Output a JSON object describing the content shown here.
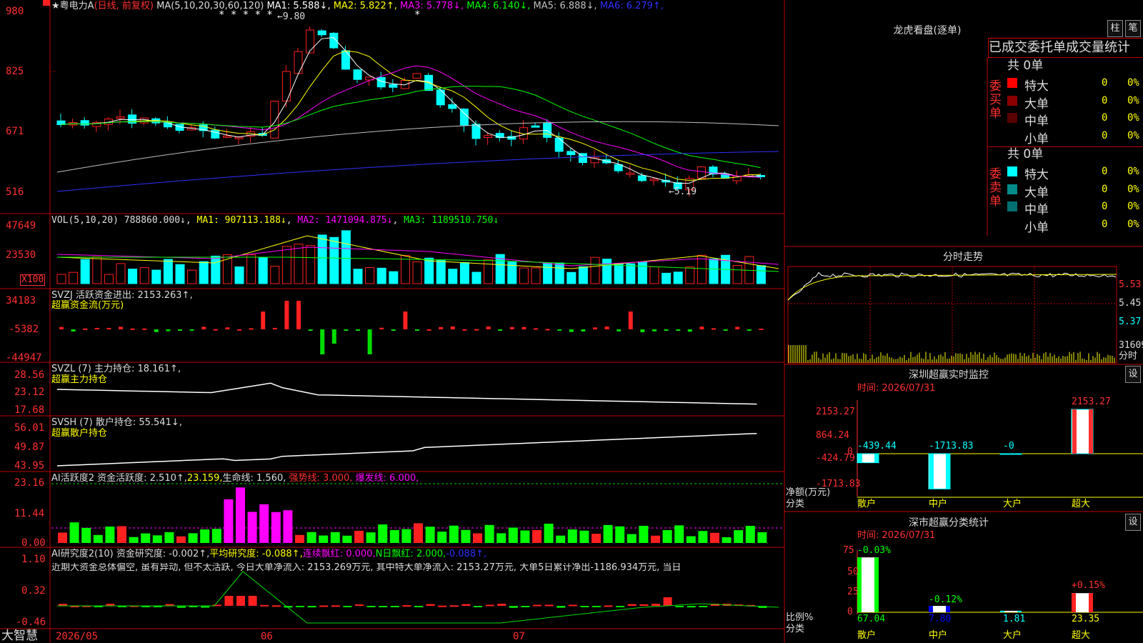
{
  "stock": {
    "name": "粤电力A",
    "period": "(日线, 前复权)",
    "ma_label": "MA(5,10,20,30,60,120)",
    "ma": [
      {
        "t": "MA1: 5.588↓",
        "c": "#ffffff"
      },
      {
        "t": "MA2: 5.822↑",
        "c": "#ffff00"
      },
      {
        "t": "MA3: 5.778↓",
        "c": "#ff00ff"
      },
      {
        "t": "MA4: 6.140↓",
        "c": "#00ff00"
      },
      {
        "t": "MA5: 6.888↓",
        "c": "#c0c0c0"
      },
      {
        "t": "MA6: 6.279↑",
        "c": "#3030ff"
      }
    ],
    "y_ticks": [
      "980",
      "825",
      "671",
      "516"
    ],
    "high_label": "9.80",
    "low_label": "←5.19",
    "stars": "* * * * *",
    "star_single": "*"
  },
  "vol": {
    "label": "VOL(5,10,20)",
    "value": "788860.000↓",
    "ma1": "MA1: 907113.188↓",
    "ma2": "MA2: 1471094.875↓",
    "ma3": "MA3: 1189510.750↓",
    "y_ticks": [
      "47649",
      "23530"
    ],
    "unit": "X100"
  },
  "svzj": {
    "label": "SVZJ  活跃资金进出: 2153.263↑,",
    "sub": "超赢资金流(万元)",
    "y_ticks": [
      "34183",
      "-5382",
      "-44947"
    ]
  },
  "svzl": {
    "label": "SVZL (7) 主力持仓: 18.161↑,",
    "sub": "超赢主力持仓",
    "y_ticks": [
      "28.56",
      "23.12",
      "17.68"
    ]
  },
  "svsh": {
    "label": "SVSH (7) 散户持仓: 55.541↓,",
    "sub": "超赢散户持仓",
    "y_ticks": [
      "56.01",
      "49.87",
      "43.95"
    ]
  },
  "ai1": {
    "label": "AI活跃度2 资金活跃度: 2.510↑,",
    "v2": "23.159,",
    "v3": "生命线: 1.560,",
    "v4": "强势线: 3.000,",
    "v5": "爆发线: 6.000,",
    "y_ticks": [
      "23.16",
      "11.44",
      "0.00"
    ]
  },
  "ai2": {
    "label": "AI研究度2(10) 资金研究度: -0.002↑,",
    "v2": "平均研究度: -0.088↑,",
    "v3": "连续飘红: 0.000,",
    "v4": "N日飘红: 2.000,",
    "v5": "-0.088↑,",
    "y_ticks": [
      "1.10",
      "0.32",
      "-0.46"
    ],
    "text": "近期大资金总体偏空, 虽有异动, 但不太活跃, 今日大单净流入: 2153.269万元, 其中特大单净流入: 2153.27万元, 大单5日累计净出-1186.934万元, 当日"
  },
  "xaxis": {
    "brand": "大智慧",
    "labels": [
      "2026/05",
      "06",
      "07"
    ]
  },
  "lhb": {
    "title": "龙虎看盘(逐单)",
    "btn1": "柱",
    "btn2": "笔",
    "subtitle": "已成交委托单成交量统计",
    "buy": {
      "side": "委买单",
      "total": "共 0单",
      "rows": [
        {
          "n": "特大",
          "v": "0",
          "p": "0%",
          "c": "#ff0000"
        },
        {
          "n": "大单",
          "v": "0",
          "p": "0%",
          "c": "#8b0000"
        },
        {
          "n": "中单",
          "v": "0",
          "p": "0%",
          "c": "#5a0000"
        },
        {
          "n": "小单",
          "v": "0",
          "p": "0%",
          "c": ""
        }
      ]
    },
    "sell": {
      "side": "委卖单",
      "total": "共 0单",
      "rows": [
        {
          "n": "特大",
          "v": "0",
          "p": "0%",
          "c": "#00ffff"
        },
        {
          "n": "大单",
          "v": "0",
          "p": "0%",
          "c": "#008b8b"
        },
        {
          "n": "中单",
          "v": "0",
          "p": "0%",
          "c": "#007070"
        },
        {
          "n": "小单",
          "v": "0",
          "p": "0%",
          "c": ""
        }
      ]
    }
  },
  "intraday": {
    "title": "分时走势",
    "y": [
      "5.53",
      "5.45",
      "5.37"
    ],
    "vol": "31609",
    "vol_unit": "分时"
  },
  "monitor": {
    "title": "深圳超赢实时监控",
    "btn": "设",
    "time": "时间: 2026/07/31",
    "y": [
      "2153.27",
      "864.24",
      "0",
      "-424.79",
      "-1713.83"
    ],
    "labels_top": [
      "-439.44",
      "-1713.83",
      "-0",
      "2153.27"
    ],
    "axis_title": "净额(万元)",
    "axis_sub": "分类",
    "cats": [
      "散户",
      "中户",
      "大户",
      "超大"
    ],
    "values": [
      -439.44,
      -1713.83,
      0,
      2153.27
    ]
  },
  "classify": {
    "title": "深市超赢分类统计",
    "btn": "设",
    "time": "时间: 2026/07/31",
    "y": [
      "75",
      "50",
      "25",
      "0"
    ],
    "pct": [
      "-0.03%",
      "-0.12%",
      "",
      "+0.15%"
    ],
    "vals": [
      "67.04",
      "7.80",
      "1.81",
      "23.35"
    ],
    "axis_title": "比例%",
    "axis_sub": "分类",
    "cats": [
      "散户",
      "中户",
      "大户",
      "超大"
    ],
    "values": [
      67.04,
      7.8,
      1.81,
      23.35
    ]
  }
}
